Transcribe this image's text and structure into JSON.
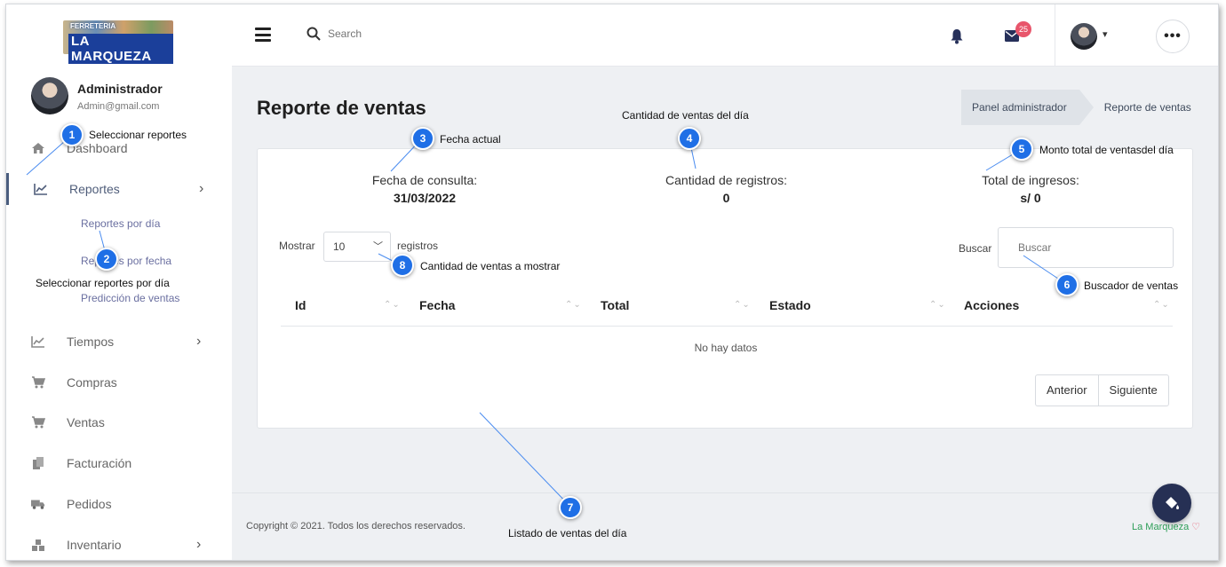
{
  "brand": {
    "logo_top": "FERRETERIA",
    "logo_main": "LA MARQUEZA"
  },
  "profile": {
    "name": "Administrador",
    "email": "Admin@gmail.com"
  },
  "topbar": {
    "search_placeholder": "Search",
    "mail_badge": "25",
    "more_label": "•••"
  },
  "sidebar": {
    "items": [
      {
        "label": "Dashboard",
        "icon": "home-icon"
      },
      {
        "label": "Reportes",
        "icon": "chart-icon",
        "active": true
      },
      {
        "label": "Tiempos",
        "icon": "chart-icon"
      },
      {
        "label": "Compras",
        "icon": "cart-icon"
      },
      {
        "label": "Ventas",
        "icon": "cart-icon"
      },
      {
        "label": "Facturación",
        "icon": "copy-icon"
      },
      {
        "label": "Pedidos",
        "icon": "truck-icon"
      },
      {
        "label": "Inventario",
        "icon": "boxes-icon"
      }
    ],
    "subitems": [
      "Reportes por día",
      "Reportes por fecha",
      "Predicción de ventas"
    ]
  },
  "page": {
    "title": "Reporte de ventas",
    "breadcrumb": [
      "Panel administrador",
      "Reporte de ventas"
    ]
  },
  "stats": {
    "fecha_label": "Fecha de consulta:",
    "fecha_value": "31/03/2022",
    "registros_label": "Cantidad de registros:",
    "registros_value": "0",
    "ingresos_label": "Total de ingresos:",
    "ingresos_value": "s/ 0"
  },
  "table": {
    "show_label": "Mostrar",
    "show_value": "10",
    "records_label": "registros",
    "search_label": "Buscar",
    "search_placeholder": "Buscar",
    "columns": [
      "Id",
      "Fecha",
      "Total",
      "Estado",
      "Acciones"
    ],
    "empty": "No hay datos",
    "prev": "Anterior",
    "next": "Siguiente"
  },
  "footer": {
    "copyright": "Copyright © 2021. Todos los derechos reservados.",
    "brand": "La Marqueza"
  },
  "callouts": [
    {
      "n": "1",
      "text": "Seleccionar reportes"
    },
    {
      "n": "2",
      "text": "Seleccionar reportes por día"
    },
    {
      "n": "3",
      "text": "Fecha actual"
    },
    {
      "n": "4",
      "text": "Cantidad de ventas del día"
    },
    {
      "n": "5",
      "text": "Monto total de ventasdel día"
    },
    {
      "n": "6",
      "text": "Buscador de ventas"
    },
    {
      "n": "7",
      "text": "Listado de ventas del día"
    },
    {
      "n": "8",
      "text": "Cantidad de ventas a mostrar"
    }
  ],
  "colors": {
    "callout": "#1f6fe6",
    "sidebar_active": "#4a5d7e",
    "badge": "#e8556b",
    "fab": "#263054"
  }
}
